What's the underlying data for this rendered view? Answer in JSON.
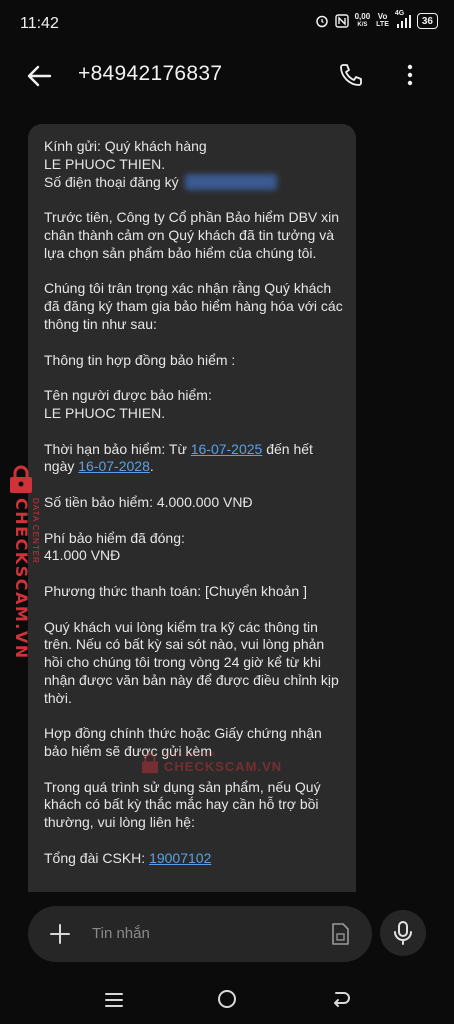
{
  "status_bar": {
    "time": "11:42",
    "net_speed_top": "0,00",
    "net_speed_bottom": "K/S",
    "vo_top": "Vo",
    "vo_bottom": "LTE",
    "signal_label": "4G",
    "battery": "36"
  },
  "header": {
    "contact": "+84942176837",
    "back_icon": "arrow-left-icon",
    "call_icon": "phone-icon",
    "menu_icon": "more-vertical-icon"
  },
  "message": {
    "greeting": "Kính gửi: Quý khách hàng",
    "customer_name": "LE PHUOC THIEN.",
    "phone_label": "Số điện thoại đăng ký",
    "para1": "Trước tiên, Công ty Cổ phần Bảo hiểm DBV xin chân thành cảm ơn Quý khách đã tin tưởng và lựa chọn sản phẩm bảo hiểm của chúng tôi.",
    "para2": "Chúng tôi trân trọng xác nhận rằng Quý khách đã đăng ký tham gia bảo hiểm hàng hóa với các thông tin như sau:",
    "contract_info": "Thông tin hợp đồng bảo hiểm :",
    "insured_label": "Tên người được bảo hiểm:",
    "insured_name": "LE PHUOC THIEN.",
    "term_prefix": "Thời hạn bảo hiểm: Từ ",
    "term_start": "16-07-2025",
    "term_middle": " đến hết ngày ",
    "term_end": "16-07-2028",
    "term_suffix": ".",
    "sum_insured": "Số tiền bảo hiểm: 4.000.000 VNĐ",
    "premium_label": "Phí bảo hiểm đã đóng:",
    "premium_value": "41.000 VNĐ",
    "payment_method": "Phương thức thanh toán: [Chuyển khoản ]",
    "para_check": "Quý khách vui lòng kiểm tra kỹ các thông tin trên. Nếu có bất kỳ sai sót nào, vui lòng phản hồi cho chúng tôi trong vòng 24 giờ kể từ khi nhận được văn bản này để được điều chỉnh kịp thời.",
    "para_contract": "Hợp đồng chính thức hoặc Giấy chứng nhận bảo hiểm sẽ được gửi kèm",
    "para_support": "Trong quá trình sử dụng sản phẩm, nếu Quý khách có bất kỳ thắc mắc hay cần hỗ trợ bồi thường, vui lòng liên hệ:",
    "hotline_prefix": "Tổng đài CSKH: ",
    "hotline": "19007102"
  },
  "watermark": {
    "side_main": "CHECKSCAM.VN",
    "side_sub": "DATA CENTER",
    "center_main": "CHECKSCAM.VN",
    "center_sub": "DATA CENTER"
  },
  "compose": {
    "placeholder": "Tin nhắn",
    "add_icon": "plus-icon",
    "attach_icon": "sim-card-icon",
    "mic_icon": "microphone-icon"
  },
  "navbar": {
    "recent_icon": "menu-lines-icon",
    "home_icon": "circle-home-icon",
    "back_icon": "back-arrow-icon"
  },
  "colors": {
    "background": "#0b0b0b",
    "bubble": "#2b2b2b",
    "link": "#5aa0e8",
    "watermark": "#d0323a"
  }
}
